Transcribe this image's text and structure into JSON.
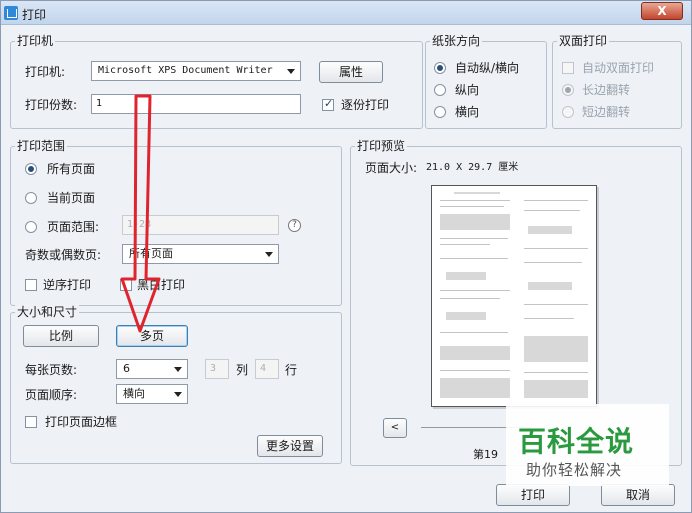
{
  "window": {
    "title": "打印",
    "close_label": "X"
  },
  "printer": {
    "legend": "打印机",
    "printer_label": "打印机:",
    "printer_value": "Microsoft XPS Document Writer",
    "properties_button": "属性",
    "copies_label": "打印份数:",
    "copies_value": "1",
    "collate_label": "逐份打印",
    "collate_checked": true
  },
  "orientation": {
    "legend": "纸张方向",
    "options": [
      "自动纵/横向",
      "纵向",
      "横向"
    ],
    "selected": 0
  },
  "duplex": {
    "legend": "双面打印",
    "enable_label": "自动双面打印",
    "options": [
      "长边翻转",
      "短边翻转"
    ],
    "selected": 0
  },
  "range": {
    "legend": "打印范围",
    "all_pages": "所有页面",
    "current_page": "当前页面",
    "page_range": "页面范围:",
    "page_range_value": "1-28",
    "help_icon": "?",
    "odd_even_label": "奇数或偶数页:",
    "odd_even_value": "所有页面",
    "reverse_label": "逆序打印",
    "grayscale_label": "黑白打印"
  },
  "size": {
    "legend": "大小和尺寸",
    "scale_button": "比例",
    "multi_page_button": "多页",
    "pages_per_sheet_label": "每张页数:",
    "pages_per_sheet_value": "6",
    "cols_value": "3",
    "cols_label": "列",
    "rows_value": "4",
    "rows_label": "行",
    "order_label": "页面顺序:",
    "order_value": "横向",
    "border_label": "打印页面边框",
    "more_settings_button": "更多设置"
  },
  "preview": {
    "legend": "打印预览",
    "paper_size_label": "页面大小:",
    "paper_size_value": "21.0 X 29.7 厘米",
    "prev_button": "<",
    "page_status": "第19"
  },
  "footer": {
    "print_button": "打印",
    "cancel_button": "取消"
  },
  "watermark": {
    "main": "百科全说",
    "sub": "助你轻松解决"
  },
  "colors": {
    "accent": "#2a4f7a",
    "arrow": "#e0242e",
    "watermark": "#2b9a3f"
  }
}
